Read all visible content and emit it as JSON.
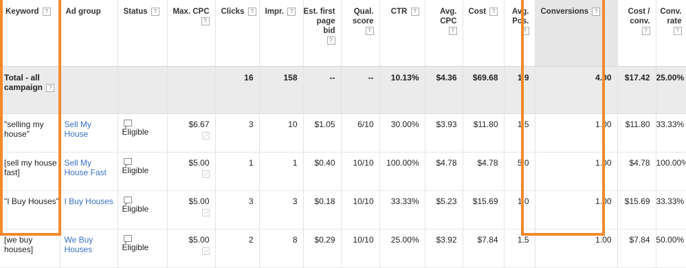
{
  "columns": [
    {
      "label": "Keyword",
      "help": true
    },
    {
      "label": "Ad group",
      "help": false
    },
    {
      "label": "Status",
      "help": true
    },
    {
      "label": "Max. CPC",
      "help": true
    },
    {
      "label": "Clicks",
      "help": true
    },
    {
      "label": "Impr.",
      "help": true
    },
    {
      "label": "Est. first page bid",
      "help": true
    },
    {
      "label": "Qual. score",
      "help": true
    },
    {
      "label": "CTR",
      "help": true
    },
    {
      "label": "Avg. CPC",
      "help": true
    },
    {
      "label": "Cost",
      "help": true
    },
    {
      "label": "Avg. Pos.",
      "help": true
    },
    {
      "label": "Conversions",
      "help": true,
      "sort": "descending"
    },
    {
      "label": "Cost / conv.",
      "help": true
    },
    {
      "label": "Conv. rate",
      "help": true
    }
  ],
  "help_glyph": "?",
  "sort_glyph": "↓",
  "total": {
    "label": "Total - all campaign",
    "clicks": "16",
    "impr": "158",
    "est_bid": "--",
    "qual": "--",
    "ctr": "10.13%",
    "avg_cpc": "$4.36",
    "cost": "$69.68",
    "avg_pos": "1.9",
    "conversions": "4.00",
    "cost_conv": "$17.42",
    "conv_rate": "25.00%"
  },
  "rows": [
    {
      "keyword": "\"selling my house\"",
      "ad_group": "Sell My House",
      "status": "Eligible",
      "max_cpc": "$6.67",
      "clicks": "3",
      "impr": "10",
      "est_bid": "$1.05",
      "qual": "6/10",
      "ctr": "30.00%",
      "avg_cpc": "$3.93",
      "cost": "$11.80",
      "avg_pos": "1.5",
      "conversions": "1.00",
      "cost_conv": "$11.80",
      "conv_rate": "33.33%"
    },
    {
      "keyword": "[sell my house fast]",
      "ad_group": "Sell My House Fast",
      "status": "Eligible",
      "max_cpc": "$5.00",
      "clicks": "1",
      "impr": "1",
      "est_bid": "$0.40",
      "qual": "10/10",
      "ctr": "100.00%",
      "avg_cpc": "$4.78",
      "cost": "$4.78",
      "avg_pos": "5.0",
      "conversions": "1.00",
      "cost_conv": "$4.78",
      "conv_rate": "100.00%"
    },
    {
      "keyword": "\"I Buy Houses\"",
      "ad_group": "I Buy Houses",
      "status": "Eligible",
      "max_cpc": "$5.00",
      "clicks": "3",
      "impr": "3",
      "est_bid": "$0.18",
      "qual": "10/10",
      "ctr": "33.33%",
      "avg_cpc": "$5.23",
      "cost": "$15.69",
      "avg_pos": "1.0",
      "conversions": "1.00",
      "cost_conv": "$15.69",
      "conv_rate": "33.33%"
    },
    {
      "keyword": "[we buy houses]",
      "ad_group": "We Buy Houses",
      "status": "Eligible",
      "max_cpc": "$5.00",
      "clicks": "2",
      "impr": "8",
      "est_bid": "$0.29",
      "qual": "10/10",
      "ctr": "25.00%",
      "avg_cpc": "$3.92",
      "cost": "$7.84",
      "avg_pos": "1.5",
      "conversions": "1.00",
      "cost_conv": "$7.84",
      "conv_rate": "50.00%"
    }
  ],
  "colors": {
    "highlight": "#f28a2e",
    "link": "#3a6fc4",
    "total_bg": "#ebebeb",
    "sorted_header_bg": "#e6e6e6"
  }
}
